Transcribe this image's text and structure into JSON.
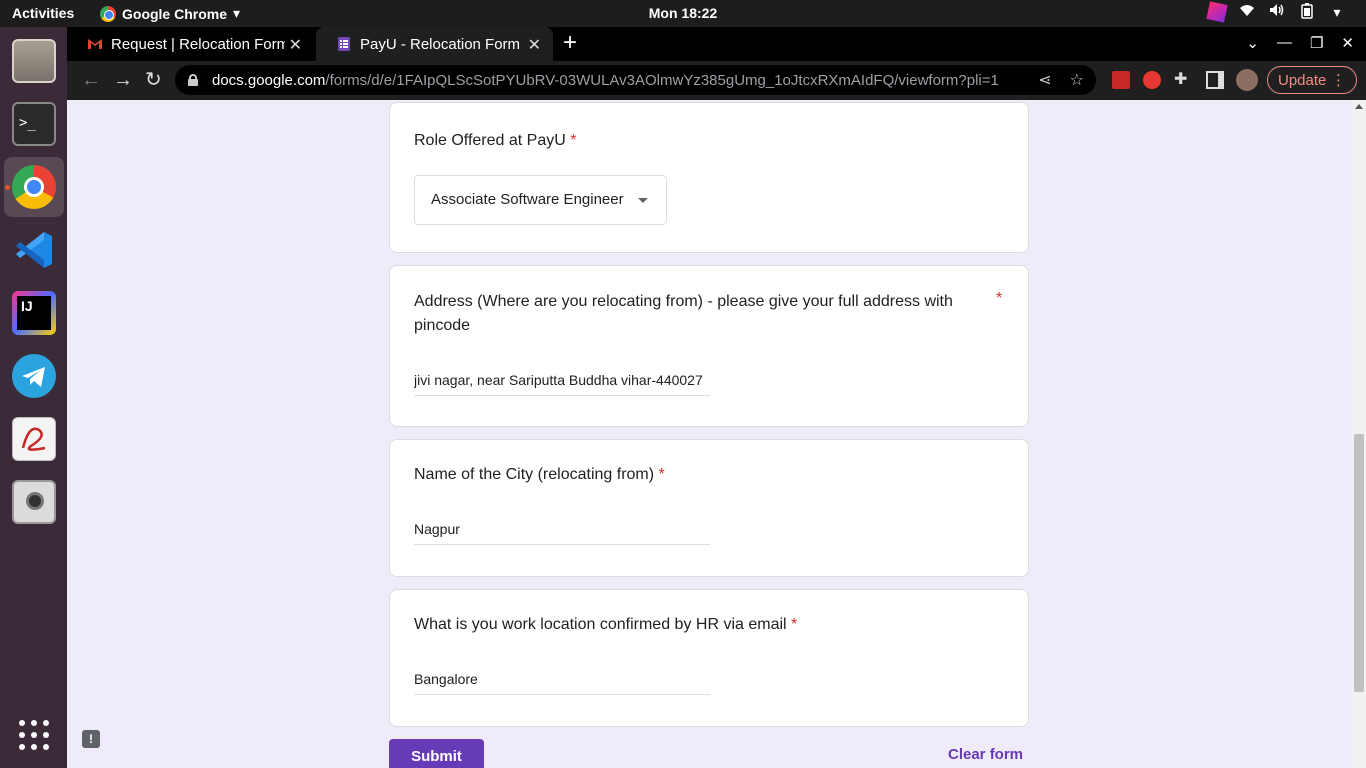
{
  "topbar": {
    "activities": "Activities",
    "app_name": "Google Chrome",
    "clock": "Mon 18:22"
  },
  "browser": {
    "tabs": [
      {
        "title": "Request | Relocation Form"
      },
      {
        "title": "PayU - Relocation Form"
      }
    ],
    "url_host": "docs.google.com",
    "url_path": "/forms/d/e/1FAIpQLScSotPYUbRV-03WULAv3AOlmwYz385gUmg_1oJtcxRXmAIdFQ/viewform?pli=1",
    "update_label": "Update"
  },
  "form": {
    "q_role": {
      "label": "Role Offered at PayU",
      "required_mark": "*",
      "value": "Associate Software Engineer"
    },
    "q_address": {
      "label": "Address (Where are you relocating from) - please give your full address with pincode",
      "required_mark": "*",
      "value": "jivi nagar, near Sariputta Buddha vihar-440027"
    },
    "q_city": {
      "label": "Name of the City (relocating from)",
      "required_mark": "*",
      "value": "Nagpur"
    },
    "q_location": {
      "label": "What is you work location confirmed by HR via email",
      "required_mark": "*",
      "value": "Bangalore"
    },
    "submit_label": "Submit",
    "clear_label": "Clear form"
  },
  "colors": {
    "accent": "#673ab7",
    "required": "#d93025",
    "background": "#f0ebf8"
  }
}
